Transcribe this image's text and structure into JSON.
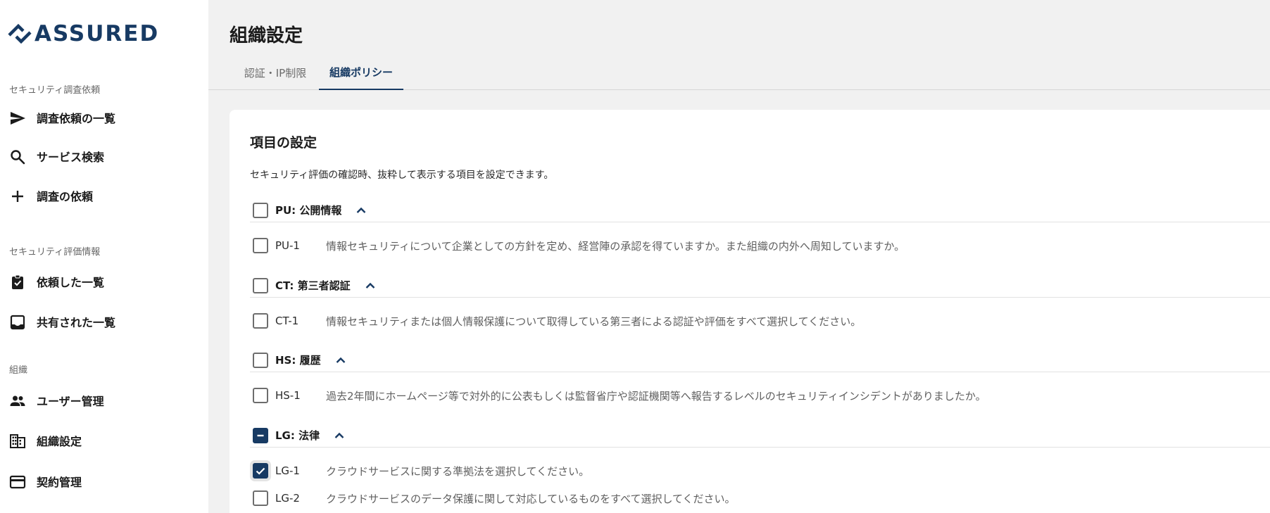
{
  "app": {
    "brand": "ASSURED",
    "colors": {
      "accent": "#173a63",
      "background": "#f1f1f1",
      "surface": "#ffffff"
    }
  },
  "sidebar": {
    "sections": [
      {
        "label": "セキュリティ調査依頼"
      },
      {
        "label": "セキュリティ評価情報"
      },
      {
        "label": "組織"
      }
    ],
    "items": [
      {
        "label": "調査依頼の一覧",
        "icon": "send-icon"
      },
      {
        "label": "サービス検索",
        "icon": "search-icon"
      },
      {
        "label": "調査の依頼",
        "icon": "plus-icon"
      },
      {
        "label": "依頼した一覧",
        "icon": "clipboard-check-icon"
      },
      {
        "label": "共有された一覧",
        "icon": "inbox-icon"
      },
      {
        "label": "ユーザー管理",
        "icon": "people-icon"
      },
      {
        "label": "組織設定",
        "icon": "building-icon"
      },
      {
        "label": "契約管理",
        "icon": "credit-card-icon"
      }
    ]
  },
  "header": {
    "title": "組織設定",
    "tabs": [
      {
        "label": "認証・IP制限",
        "active": false
      },
      {
        "label": "組織ポリシー",
        "active": true
      }
    ]
  },
  "settings": {
    "title": "項目の設定",
    "description": "セキュリティ評価の確認時、抜粋して表示する項目を設定できます。",
    "groups": [
      {
        "label": "PU: 公開情報",
        "state": "unchecked",
        "items": [
          {
            "code": "PU-1",
            "text": "情報セキュリティについて企業としての方針を定め、経営陣の承認を得ていますか。また組織の内外へ周知していますか。",
            "checked": false
          }
        ]
      },
      {
        "label": "CT: 第三者認証",
        "state": "unchecked",
        "items": [
          {
            "code": "CT-1",
            "text": "情報セキュリティまたは個人情報保護について取得している第三者による認証や評価をすべて選択してください。",
            "checked": false
          }
        ]
      },
      {
        "label": "HS: 履歴",
        "state": "unchecked",
        "items": [
          {
            "code": "HS-1",
            "text": "過去2年間にホームページ等で対外的に公表もしくは監督省庁や認証機関等へ報告するレベルのセキュリティインシデントがありましたか。",
            "checked": false
          }
        ]
      },
      {
        "label": "LG: 法律",
        "state": "indeterminate",
        "items": [
          {
            "code": "LG-1",
            "text": "クラウドサービスに関する準拠法を選択してください。",
            "checked": true
          },
          {
            "code": "LG-2",
            "text": "クラウドサービスのデータ保護に関して対応しているものをすべて選択してください。",
            "checked": false
          }
        ]
      }
    ]
  }
}
